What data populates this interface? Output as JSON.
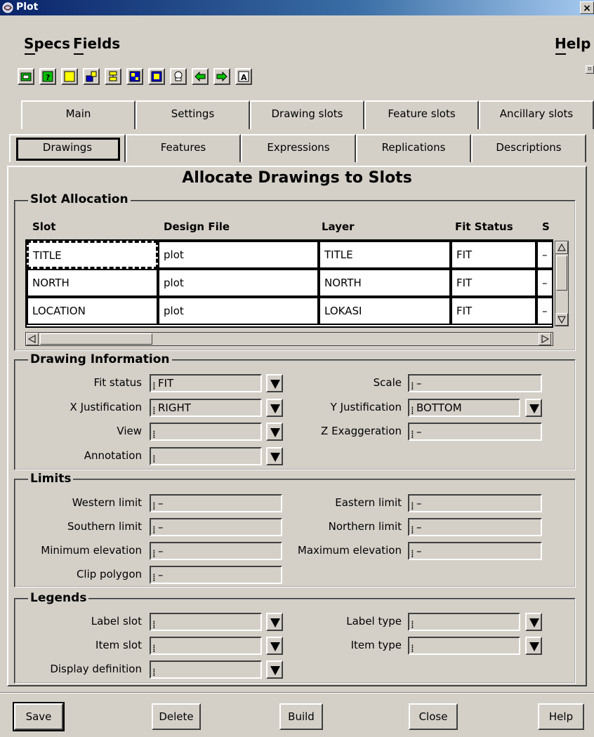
{
  "window": {
    "title": "Plot",
    "close_label": "×"
  },
  "menu": {
    "specs": "Specs",
    "fields": "Fields",
    "help": "Help"
  },
  "toolbar": {
    "icons": [
      "design-file-icon",
      "query-icon",
      "yellow-square-icon",
      "move-icon",
      "align-icon",
      "grid-icon",
      "select-icon",
      "stamp-icon",
      "back-arrow-icon",
      "forward-arrow-icon",
      "text-icon"
    ]
  },
  "tabs_row1": [
    "Main",
    "Settings",
    "Drawing slots",
    "Feature slots",
    "Ancillary slots"
  ],
  "tabs_row2": [
    "Drawings",
    "Features",
    "Expressions",
    "Replications",
    "Descriptions"
  ],
  "heading": "Allocate Drawings to Slots",
  "slot_allocation": {
    "title": "Slot Allocation",
    "columns": [
      "Slot",
      "Design File",
      "Layer",
      "Fit Status",
      "S"
    ],
    "rows": [
      [
        "TITLE",
        "plot",
        "TITLE",
        "FIT",
        "–"
      ],
      [
        "NORTH",
        "plot",
        "NORTH",
        "FIT",
        "–"
      ],
      [
        "LOCATION",
        "plot",
        "LOKASI",
        "FIT",
        "–"
      ]
    ]
  },
  "drawing_info": {
    "title": "Drawing Information",
    "fit_status_label": "Fit status",
    "fit_status_value": "FIT",
    "x_just_label": "X Justification",
    "x_just_value": "RIGHT",
    "view_label": "View",
    "view_value": "",
    "annotation_label": "Annotation",
    "annotation_value": "",
    "scale_label": "Scale",
    "scale_value": "–",
    "y_just_label": "Y Justification",
    "y_just_value": "BOTTOM",
    "z_exag_label": "Z Exaggeration",
    "z_exag_value": "–"
  },
  "limits": {
    "title": "Limits",
    "western_label": "Western limit",
    "western_value": "–",
    "southern_label": "Southern limit",
    "southern_value": "–",
    "min_elev_label": "Minimum elevation",
    "min_elev_value": "–",
    "clip_label": "Clip polygon",
    "clip_value": "–",
    "eastern_label": "Eastern limit",
    "eastern_value": "–",
    "northern_label": "Northern limit",
    "northern_value": "–",
    "max_elev_label": "Maximum elevation",
    "max_elev_value": "–"
  },
  "legends": {
    "title": "Legends",
    "label_slot_label": "Label slot",
    "label_slot_value": "",
    "item_slot_label": "Item slot",
    "item_slot_value": "",
    "display_def_label": "Display definition",
    "display_def_value": "",
    "label_type_label": "Label type",
    "label_type_value": "",
    "item_type_label": "Item type",
    "item_type_value": ""
  },
  "buttons": {
    "save": "Save",
    "delete": "Delete",
    "build": "Build",
    "close": "Close",
    "help": "Help"
  }
}
